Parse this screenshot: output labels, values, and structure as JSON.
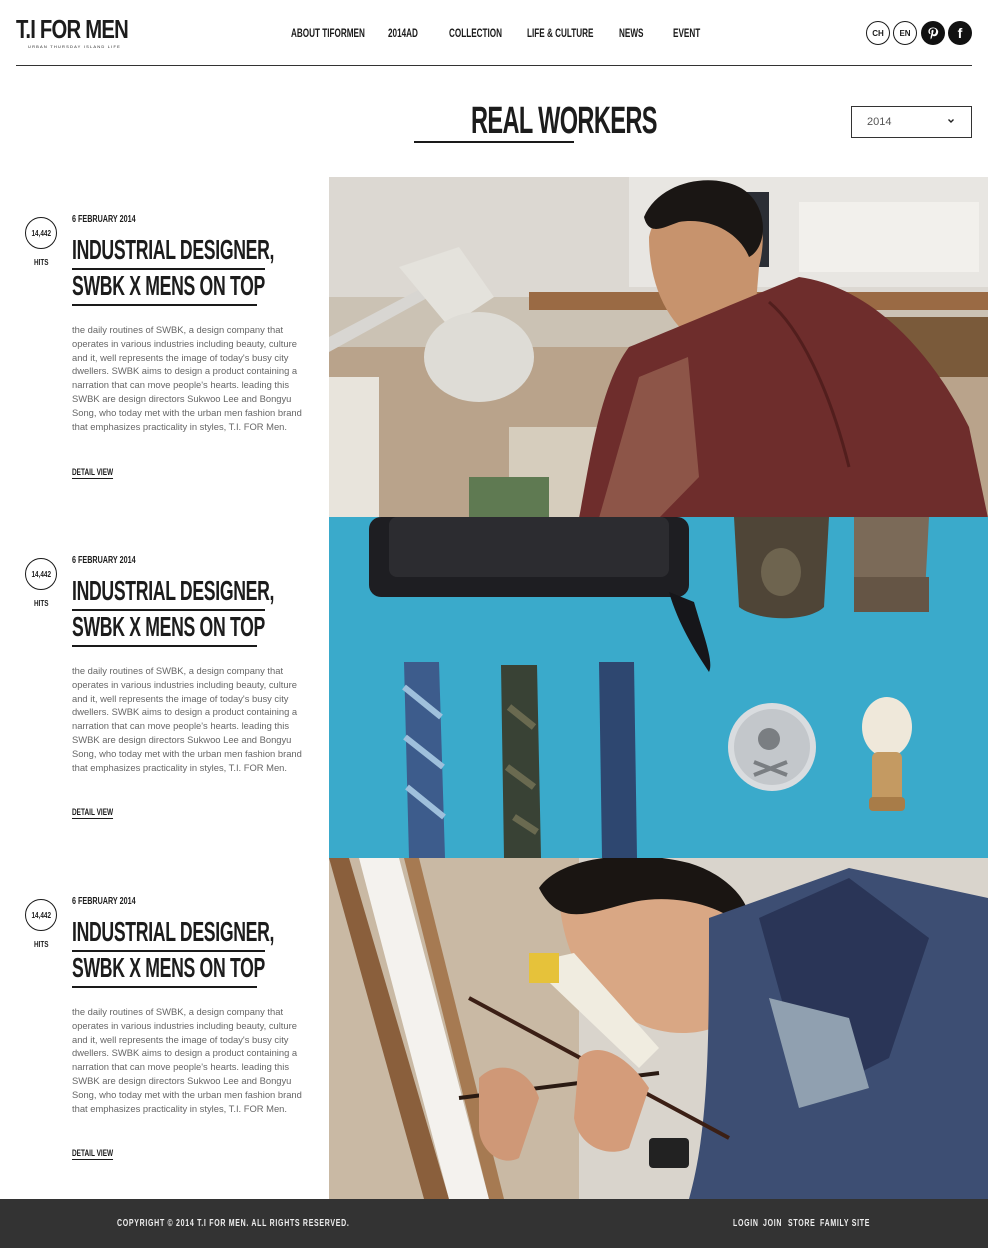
{
  "brand": {
    "name": "T.I FOR MEN",
    "tagline": "URBAN THURSDAY ISLAND LIFE"
  },
  "nav": {
    "items": [
      "ABOUT TIFORMEN",
      "2014AD",
      "COLLECTION",
      "LIFE & CULTURE",
      "NEWS",
      "EVENT"
    ]
  },
  "header_actions": {
    "lang_ch": "CH",
    "lang_en": "EN",
    "social": [
      "pinterest-icon",
      "facebook-icon"
    ],
    "facebook_glyph": "f"
  },
  "page": {
    "title": "REAL WORKERS",
    "year_selected": "2014"
  },
  "articles": [
    {
      "hits": "14,442",
      "hits_label": "HITS",
      "date": "6 FEBRUARY 2014",
      "title_line1": "INDUSTRIAL DESIGNER,",
      "title_line2": "SWBK X MENS ON TOP",
      "body": "the daily routines of SWBK, a design company that operates in various industries including beauty, culture and it, well represents the image of today's busy city dwellers. SWBK aims to design a product containing a narration that can move people's hearts. leading this SWBK are design directors Sukwoo Lee and Bongyu Song, who today met with the urban men fashion brand that emphasizes practicality in styles, T.I. FOR Men.",
      "detail_label": "DETAIL VIEW",
      "photo": "designer-at-desk-lamp"
    },
    {
      "hits": "14,442",
      "hits_label": "HITS",
      "date": "6 FEBRUARY 2014",
      "title_line1": "INDUSTRIAL DESIGNER,",
      "title_line2": "SWBK X MENS ON TOP",
      "body": "the daily routines of SWBK, a design company that operates in various industries including beauty, culture and it, well represents the image of today's busy city dwellers. SWBK aims to design a product containing a narration that can move people's hearts. leading this SWBK are design directors Sukwoo Lee and Bongyu Song, who today met with the urban men fashion brand that emphasizes practicality in styles, T.I. FOR Men.",
      "detail_label": "DETAIL VIEW",
      "photo": "accessories-flatlay"
    },
    {
      "hits": "14,442",
      "hits_label": "HITS",
      "date": "6 FEBRUARY 2014",
      "title_line1": "INDUSTRIAL DESIGNER,",
      "title_line2": "SWBK X MENS ON TOP",
      "body": "the daily routines of SWBK, a design company that operates in various industries including beauty, culture and it, well represents the image of today's busy city dwellers. SWBK aims to design a product containing a narration that can move people's hearts. leading this SWBK are design directors Sukwoo Lee and Bongyu Song, who today met with the urban men fashion brand that emphasizes practicality in styles, T.I. FOR Men.",
      "detail_label": "DETAIL VIEW",
      "photo": "artist-painting"
    }
  ],
  "footer": {
    "copyright": "COPYRIGHT © 2014 T.I FOR MEN. ALL RIGHTS RESERVED.",
    "links": [
      "LOGIN",
      "JOIN",
      "STORE",
      "FAMILY SITE"
    ]
  },
  "colors": {
    "text": "#1c1c1c",
    "body_text": "#666666",
    "footer_bg": "#333333",
    "flatlay_bg": "#3aaacb"
  }
}
